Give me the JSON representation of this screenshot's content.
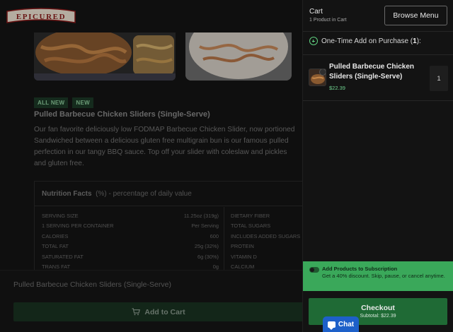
{
  "brand": {
    "logo_text": "EPICURED"
  },
  "product": {
    "badges": [
      "ALL NEW",
      "NEW"
    ],
    "title": "Pulled Barbecue Chicken Sliders (Single-Serve)",
    "description_lines": [
      "Our fan favorite deliciously low FODMAP Barbecue Chicken Slider, now portioned",
      "Sandwiched between a delicious gluten free multigrain bun is our famous pulled",
      "perfection in our tangy BBQ sauce. Top off your slider with coleslaw and pickles",
      "and gluten free."
    ]
  },
  "nutrition": {
    "heading": "Nutrition Facts",
    "heading_note": "(%) - percentage of daily value",
    "left_rows": [
      {
        "label": "SERVING SIZE",
        "value": "11.25oz (319g)"
      },
      {
        "label": "1 SERVING PER CONTAINER",
        "value": "Per Serving"
      },
      {
        "label": "CALORIES",
        "value": "600"
      },
      {
        "label": "TOTAL FAT",
        "value": "25g  (32%)"
      },
      {
        "label": "SATURATED FAT",
        "value": "6g  (30%)"
      },
      {
        "label": "TRANS FAT",
        "value": "0g"
      }
    ],
    "right_rows": [
      {
        "label": "DIETARY FIBER"
      },
      {
        "label": "TOTAL SUGARS"
      },
      {
        "label": "INCLUDES ADDED SUGARS"
      },
      {
        "label": "PROTEIN"
      },
      {
        "label": "VITAMIN D"
      },
      {
        "label": "CALCIUM"
      }
    ]
  },
  "bottom_bar": {
    "title": "Pulled Barbecue Chicken Sliders (Single-Serve)",
    "add_to_cart": "Add to Cart"
  },
  "cart": {
    "title": "Cart",
    "count_text": "1 Product in Cart",
    "browse_menu": "Browse Menu",
    "one_time_label": "One-Time Add on Purchase (",
    "one_time_count": "1",
    "one_time_suffix": "):",
    "item": {
      "name": "Pulled Barbecue Chicken Sliders (Single-Serve)",
      "price": "$22.39",
      "quantity": "1"
    },
    "subscription": {
      "title": "Add Products to Subscription",
      "text": "Get a 40% discount. Skip, pause, or cancel anytime.",
      "enabled": false
    },
    "checkout_label": "Checkout",
    "subtotal": "Subtotal: $22.39"
  },
  "chat": {
    "label": "Chat"
  },
  "colors": {
    "accent_green": "#3aa85a",
    "checkout_green": "#1f6a35",
    "price_green": "#6fd18f",
    "chat_blue": "#1d60c9",
    "logo_red": "#8b1a1a"
  }
}
